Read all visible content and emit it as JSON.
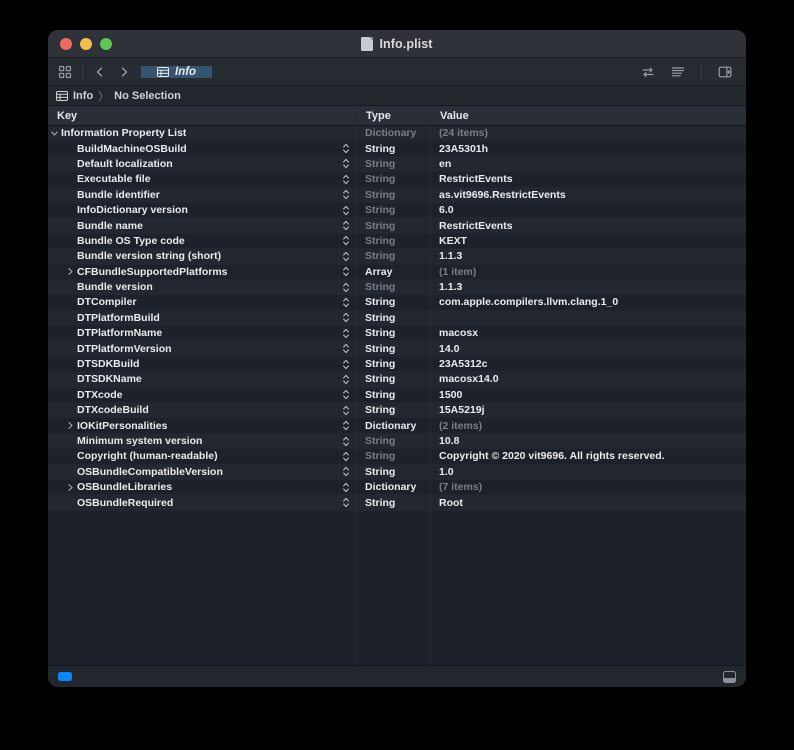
{
  "window": {
    "title": "Info.plist",
    "traffic_lights": [
      "close-red",
      "minimize-yellow",
      "zoom-green"
    ]
  },
  "toolbar": {
    "left_icons": [
      "grid-navigator-icon",
      "back-chevron-icon",
      "forward-chevron-icon"
    ],
    "tab_label": "Info",
    "right_icons": [
      "swap-arrows-icon",
      "list-lines-icon",
      "inspector-panel-icon"
    ]
  },
  "breadcrumb": {
    "root": "Info",
    "separator": "〉",
    "selection": "No Selection"
  },
  "columns": {
    "key": "Key",
    "type": "Type",
    "value": "Value"
  },
  "statusbar": {
    "left_icon": "blue-tag-icon",
    "right_icon": "show-panel-icon"
  },
  "rows": [
    {
      "key": "Information Property List",
      "indent": 0,
      "disclosure": "expanded",
      "stepper": false,
      "type": "Dictionary",
      "type_dim": true,
      "value": "(24 items)",
      "value_dim": true
    },
    {
      "key": "BuildMachineOSBuild",
      "indent": 1,
      "disclosure": "none",
      "stepper": true,
      "type": "String",
      "type_dim": false,
      "value": "23A5301h",
      "value_dim": false
    },
    {
      "key": "Default localization",
      "indent": 1,
      "disclosure": "none",
      "stepper": true,
      "type": "String",
      "type_dim": true,
      "value": "en",
      "value_dim": false
    },
    {
      "key": "Executable file",
      "indent": 1,
      "disclosure": "none",
      "stepper": true,
      "type": "String",
      "type_dim": true,
      "value": "RestrictEvents",
      "value_dim": false
    },
    {
      "key": "Bundle identifier",
      "indent": 1,
      "disclosure": "none",
      "stepper": true,
      "type": "String",
      "type_dim": true,
      "value": "as.vit9696.RestrictEvents",
      "value_dim": false
    },
    {
      "key": "InfoDictionary version",
      "indent": 1,
      "disclosure": "none",
      "stepper": true,
      "type": "String",
      "type_dim": true,
      "value": "6.0",
      "value_dim": false
    },
    {
      "key": "Bundle name",
      "indent": 1,
      "disclosure": "none",
      "stepper": true,
      "type": "String",
      "type_dim": true,
      "value": "RestrictEvents",
      "value_dim": false
    },
    {
      "key": "Bundle OS Type code",
      "indent": 1,
      "disclosure": "none",
      "stepper": true,
      "type": "String",
      "type_dim": true,
      "value": "KEXT",
      "value_dim": false
    },
    {
      "key": "Bundle version string (short)",
      "indent": 1,
      "disclosure": "none",
      "stepper": true,
      "type": "String",
      "type_dim": true,
      "value": "1.1.3",
      "value_dim": false
    },
    {
      "key": "CFBundleSupportedPlatforms",
      "indent": 1,
      "disclosure": "collapsed",
      "stepper": true,
      "type": "Array",
      "type_dim": false,
      "value": "(1 item)",
      "value_dim": true
    },
    {
      "key": "Bundle version",
      "indent": 1,
      "disclosure": "none",
      "stepper": true,
      "type": "String",
      "type_dim": true,
      "value": "1.1.3",
      "value_dim": false
    },
    {
      "key": "DTCompiler",
      "indent": 1,
      "disclosure": "none",
      "stepper": true,
      "type": "String",
      "type_dim": false,
      "value": "com.apple.compilers.llvm.clang.1_0",
      "value_dim": false
    },
    {
      "key": "DTPlatformBuild",
      "indent": 1,
      "disclosure": "none",
      "stepper": true,
      "type": "String",
      "type_dim": false,
      "value": "",
      "value_dim": false
    },
    {
      "key": "DTPlatformName",
      "indent": 1,
      "disclosure": "none",
      "stepper": true,
      "type": "String",
      "type_dim": false,
      "value": "macosx",
      "value_dim": false
    },
    {
      "key": "DTPlatformVersion",
      "indent": 1,
      "disclosure": "none",
      "stepper": true,
      "type": "String",
      "type_dim": false,
      "value": "14.0",
      "value_dim": false
    },
    {
      "key": "DTSDKBuild",
      "indent": 1,
      "disclosure": "none",
      "stepper": true,
      "type": "String",
      "type_dim": false,
      "value": "23A5312c",
      "value_dim": false
    },
    {
      "key": "DTSDKName",
      "indent": 1,
      "disclosure": "none",
      "stepper": true,
      "type": "String",
      "type_dim": false,
      "value": "macosx14.0",
      "value_dim": false
    },
    {
      "key": "DTXcode",
      "indent": 1,
      "disclosure": "none",
      "stepper": true,
      "type": "String",
      "type_dim": false,
      "value": "1500",
      "value_dim": false
    },
    {
      "key": "DTXcodeBuild",
      "indent": 1,
      "disclosure": "none",
      "stepper": true,
      "type": "String",
      "type_dim": false,
      "value": "15A5219j",
      "value_dim": false
    },
    {
      "key": "IOKitPersonalities",
      "indent": 1,
      "disclosure": "collapsed",
      "stepper": true,
      "type": "Dictionary",
      "type_dim": false,
      "value": "(2 items)",
      "value_dim": true
    },
    {
      "key": "Minimum system version",
      "indent": 1,
      "disclosure": "none",
      "stepper": true,
      "type": "String",
      "type_dim": true,
      "value": "10.8",
      "value_dim": false
    },
    {
      "key": "Copyright (human-readable)",
      "indent": 1,
      "disclosure": "none",
      "stepper": true,
      "type": "String",
      "type_dim": true,
      "value": "Copyright © 2020 vit9696. All rights reserved.",
      "value_dim": false
    },
    {
      "key": "OSBundleCompatibleVersion",
      "indent": 1,
      "disclosure": "none",
      "stepper": true,
      "type": "String",
      "type_dim": false,
      "value": "1.0",
      "value_dim": false
    },
    {
      "key": "OSBundleLibraries",
      "indent": 1,
      "disclosure": "collapsed",
      "stepper": true,
      "type": "Dictionary",
      "type_dim": false,
      "value": "(7 items)",
      "value_dim": true
    },
    {
      "key": "OSBundleRequired",
      "indent": 1,
      "disclosure": "none",
      "stepper": true,
      "type": "String",
      "type_dim": false,
      "value": "Root",
      "value_dim": false
    }
  ],
  "colors": {
    "accent_tab": "#37546f",
    "accent_blue": "#0a84ff",
    "window_bg": "#1d2129",
    "titlebar_bg": "#2f3239"
  }
}
